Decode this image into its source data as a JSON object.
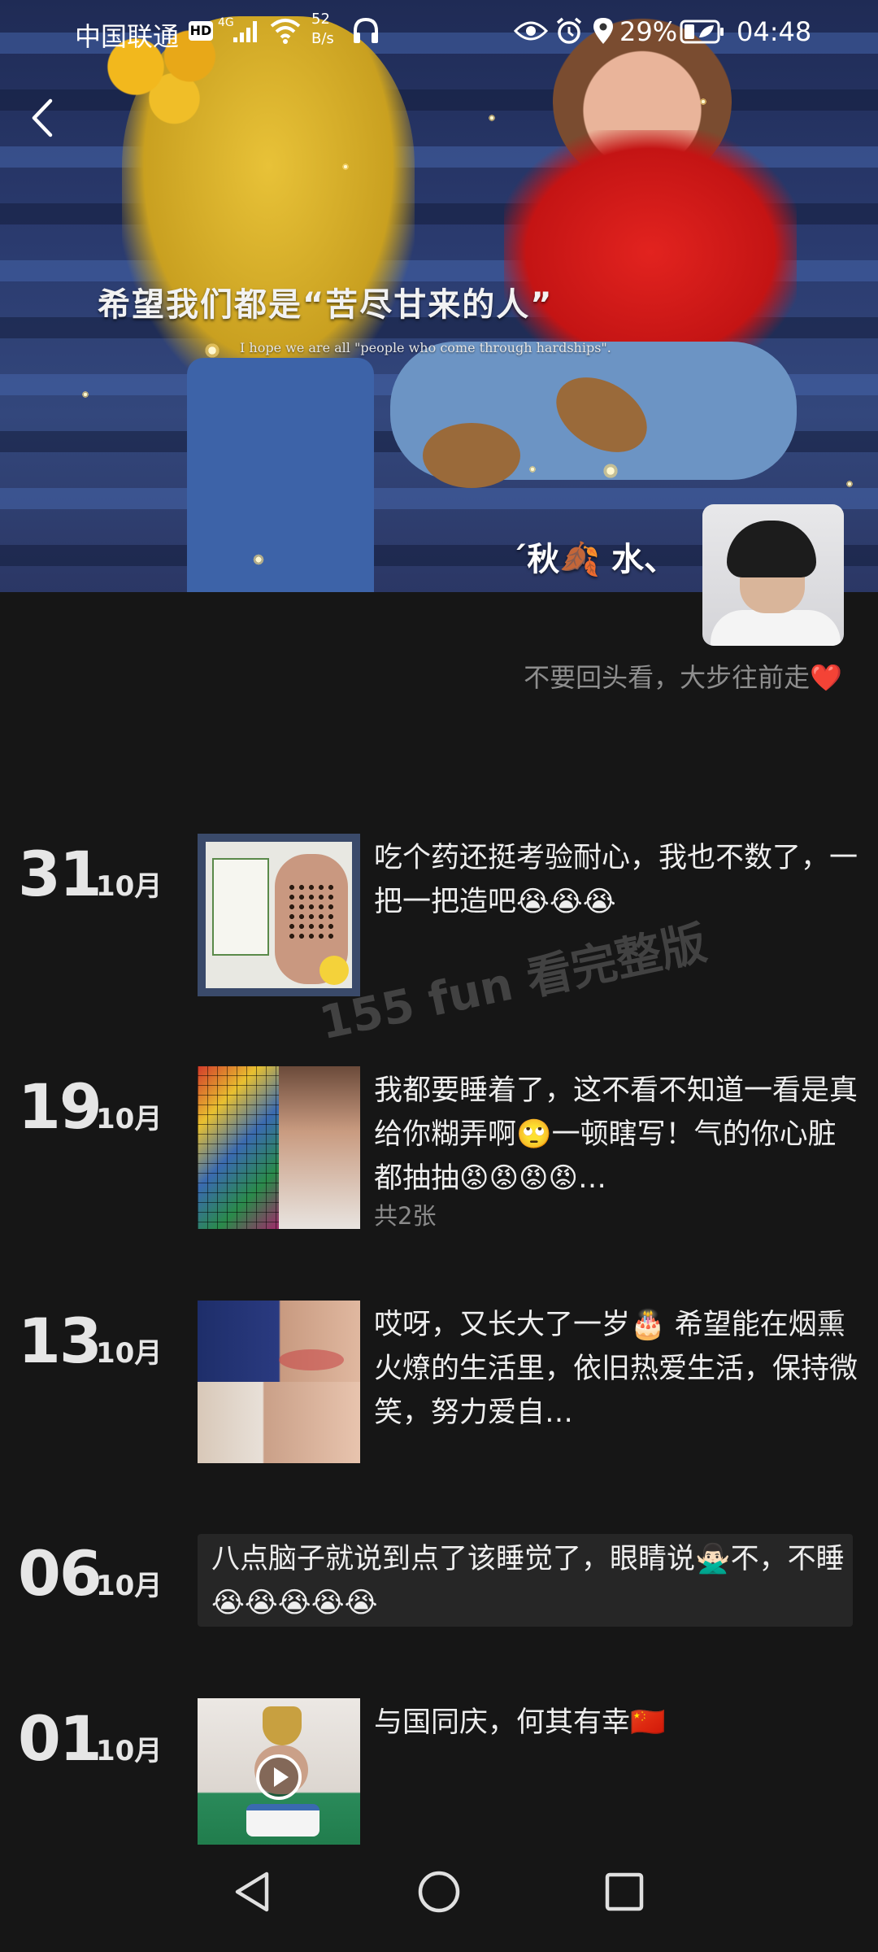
{
  "status_bar": {
    "carrier": "中国联通",
    "hd": "HD",
    "net_gen": "4G",
    "speed_value": "52",
    "speed_unit": "B/s",
    "battery": "29%",
    "time": "04:48",
    "icons": [
      "signal-icon",
      "wifi-icon",
      "headphones-icon",
      "eye-icon",
      "alarm-icon",
      "location-icon",
      "battery-icon"
    ]
  },
  "cover": {
    "quote_cn": "希望我们都是“苦尽甘来的人”",
    "quote_en": "I hope we are all \"people who come through hardships\"."
  },
  "profile": {
    "nickname": "´秋🍂 水、",
    "signature": "不要回头看，大步往前走❤️"
  },
  "watermark": "155 fun 看完整版",
  "posts": [
    {
      "day": "31",
      "month": "10月",
      "text": "吃个药还挺考验耐心，我也不数了，一把一把造吧😭😭😭",
      "has_image": true
    },
    {
      "day": "19",
      "month": "10月",
      "text": "我都要睡着了，这不看不知道一看是真给你糊弄啊🙄一顿瞎写！气的你心脏都抽抽😡😡😡😡…",
      "count": "共2张",
      "has_image": true
    },
    {
      "day": "13",
      "month": "10月",
      "text": "哎呀，又长大了一岁🎂 希望能在烟熏火燎的生活里，依旧热爱生活，保持微笑，努力爱自…",
      "has_image": true
    },
    {
      "day": "06",
      "month": "10月",
      "text": "八点脑子就说到点了该睡觉了，眼睛说🙅🏻‍♂️不，不睡😭😭😭😭😭",
      "has_image": false
    },
    {
      "day": "01",
      "month": "10月",
      "text": "与国同庆，何其有幸🇨🇳",
      "has_image": true,
      "is_video": true
    }
  ],
  "nav": {
    "back": "back-triangle-icon",
    "home": "home-circle-icon",
    "recents": "recents-square-icon"
  },
  "colors": {
    "background": "#161616",
    "text_box": "#262626",
    "muted_text": "#8e8e8e"
  }
}
